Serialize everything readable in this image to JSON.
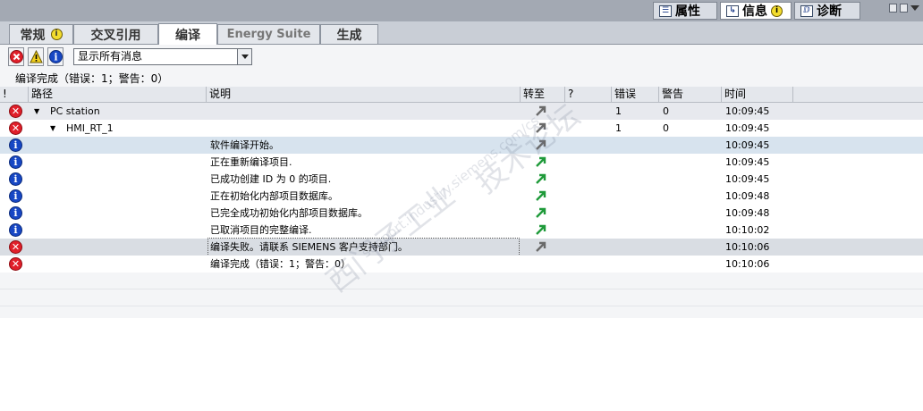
{
  "inspector_tabs": [
    {
      "label": "属性",
      "icon": "properties-icon"
    },
    {
      "label": "信息",
      "icon": "info-icon",
      "badge": "i"
    },
    {
      "label": "诊断",
      "icon": "diagnostics-icon"
    }
  ],
  "tabs": [
    {
      "label": "常规",
      "badge": "i"
    },
    {
      "label": "交叉引用"
    },
    {
      "label": "编译",
      "active": true
    },
    {
      "label": "Energy Suite"
    },
    {
      "label": "生成"
    }
  ],
  "toolbar": {
    "filter_value": "显示所有消息",
    "buttons": [
      "error-filter",
      "warning-filter",
      "info-filter"
    ]
  },
  "summary": "编译完成（错误：1；警告：0）",
  "columns": {
    "flag": "!",
    "path": "路径",
    "description": "说明",
    "goto": "转至",
    "question": "?",
    "errors": "错误",
    "warnings": "警告",
    "time": "时间"
  },
  "rows": [
    {
      "type": "error",
      "path": "PC station",
      "level": 0,
      "description": "",
      "goto": true,
      "errors": "1",
      "warnings": "0",
      "time": "10:09:45"
    },
    {
      "type": "error",
      "path": "HMI_RT_1",
      "level": 1,
      "description": "",
      "goto": true,
      "errors": "1",
      "warnings": "0",
      "time": "10:09:45"
    },
    {
      "type": "info",
      "path": "",
      "description": "软件编译开始。",
      "goto": true,
      "errors": "",
      "warnings": "",
      "time": "10:09:45"
    },
    {
      "type": "info",
      "path": "",
      "description": "正在重新编译项目.",
      "goto": true,
      "errors": "",
      "warnings": "",
      "time": "10:09:45"
    },
    {
      "type": "info",
      "path": "",
      "description": "已成功创建 ID 为 0 的项目.",
      "goto": true,
      "errors": "",
      "warnings": "",
      "time": "10:09:45"
    },
    {
      "type": "info",
      "path": "",
      "description": "正在初始化内部项目数据库。",
      "goto": true,
      "errors": "",
      "warnings": "",
      "time": "10:09:48"
    },
    {
      "type": "info",
      "path": "",
      "description": "已完全成功初始化内部项目数据库。",
      "goto": true,
      "errors": "",
      "warnings": "",
      "time": "10:09:48"
    },
    {
      "type": "info",
      "path": "",
      "description": "已取消项目的完整编译.",
      "goto": true,
      "errors": "",
      "warnings": "",
      "time": "10:10:02"
    },
    {
      "type": "error",
      "path": "",
      "description": "编译失败。请联系 SIEMENS 客户支持部门。",
      "goto": true,
      "errors": "",
      "warnings": "",
      "time": "10:10:06"
    },
    {
      "type": "error",
      "path": "",
      "description": "编译完成（错误：1；警告：0）",
      "goto": false,
      "errors": "",
      "warnings": "",
      "time": "10:10:06"
    }
  ],
  "colors": {
    "error": "#e01f2a",
    "info": "#1747c4",
    "goto_green": "#1f9a3a",
    "goto_gray": "#6a6a6a"
  },
  "watermark": [
    "西门子工业",
    "技术论坛",
    "support.industry.siemens.com/cs"
  ]
}
